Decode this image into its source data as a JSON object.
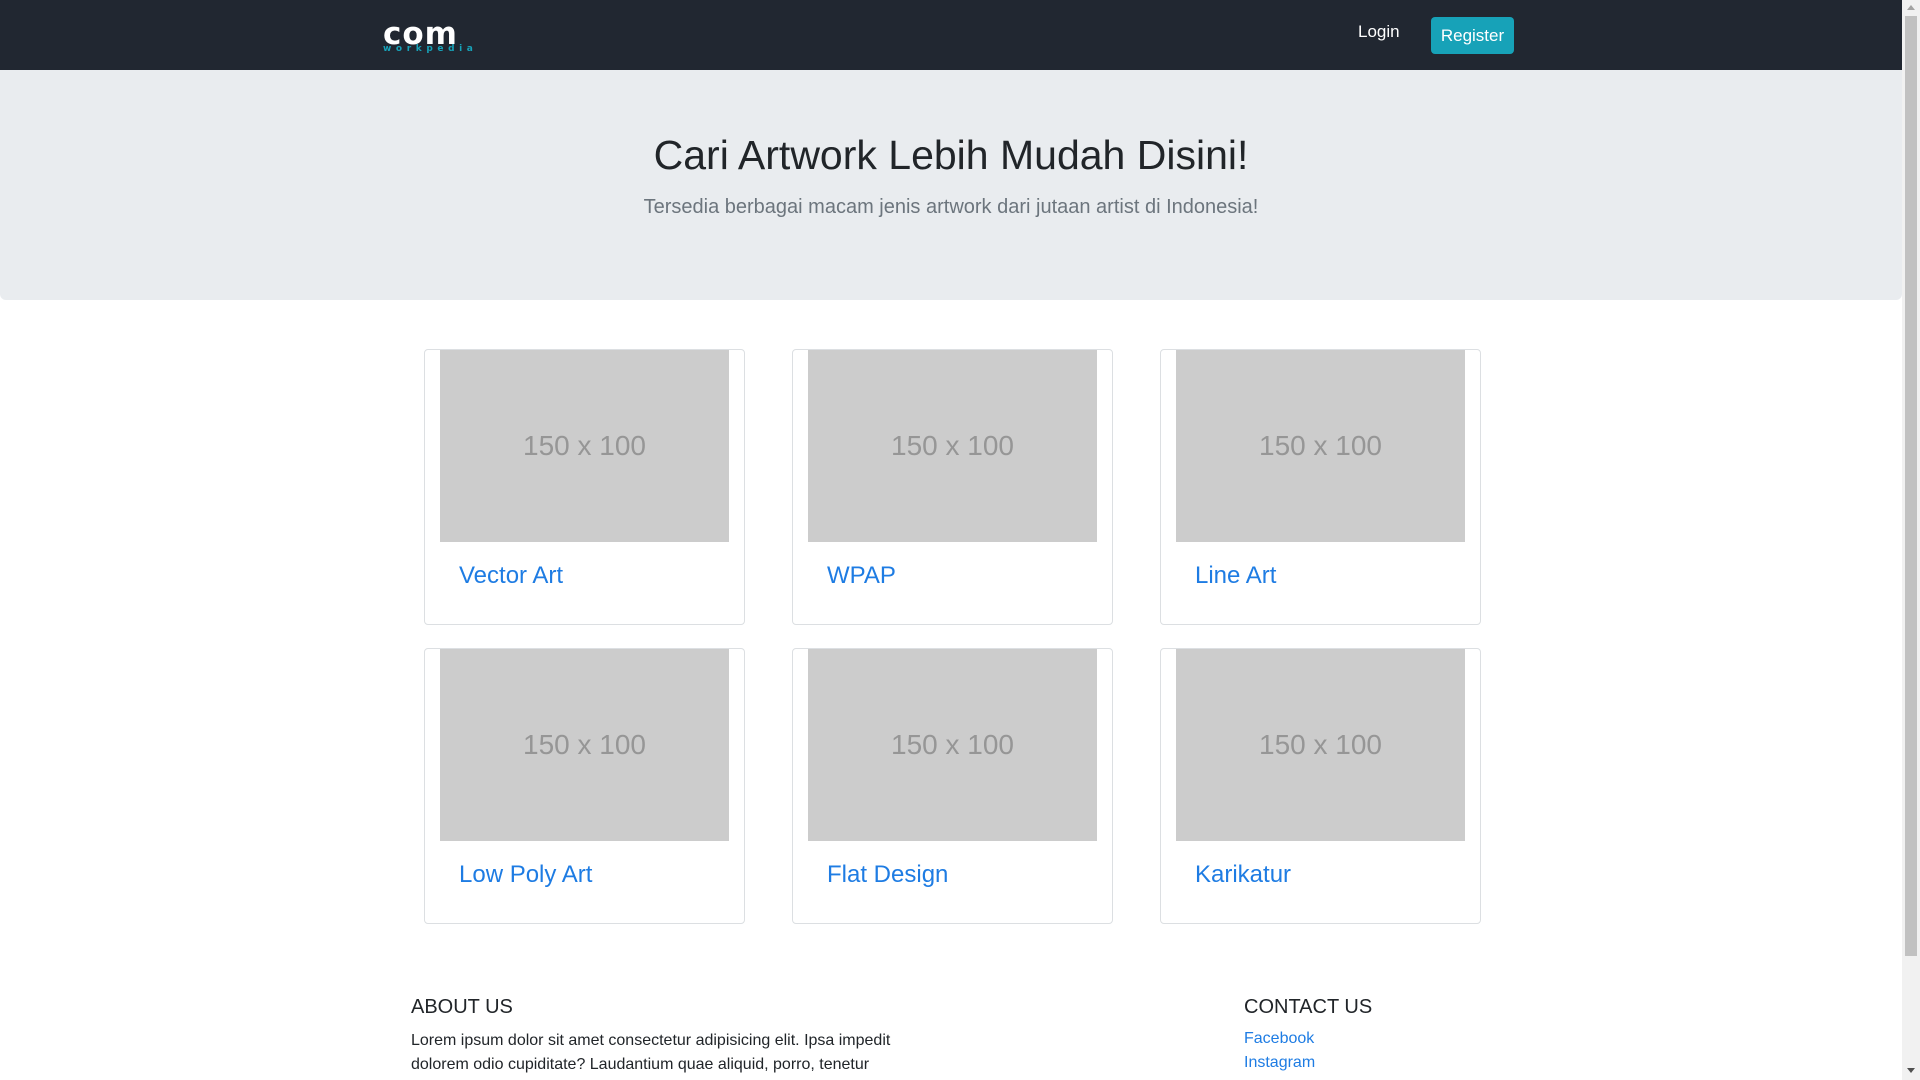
{
  "navbar": {
    "brand_main": "com",
    "brand_sub": "workpedia",
    "login_label": "Login",
    "register_label": "Register"
  },
  "jumbotron": {
    "title": "Cari Artwork Lebih Mudah Disini!",
    "lead": "Tersedia berbagai macam jenis artwork dari jutaan artist di Indonesia!"
  },
  "cards": [
    {
      "image_label": "150 x 100",
      "title": "Vector Art"
    },
    {
      "image_label": "150 x 100",
      "title": "WPAP"
    },
    {
      "image_label": "150 x 100",
      "title": "Line Art"
    },
    {
      "image_label": "150 x 100",
      "title": "Low Poly Art"
    },
    {
      "image_label": "150 x 100",
      "title": "Flat Design"
    },
    {
      "image_label": "150 x 100",
      "title": "Karikatur"
    }
  ],
  "footer": {
    "about_heading": "ABOUT US",
    "about_text": "Lorem ipsum dolor sit amet consectetur adipisicing elit. Ipsa impedit dolorem odio cupiditate? Laudantium quae aliquid, porro, tenetur",
    "contact_heading": "CONTACT US",
    "links": [
      "Facebook",
      "Instagram"
    ]
  },
  "colors": {
    "navbar_bg": "#212731",
    "accent": "#17a2b8",
    "link": "#1e7ce3",
    "jumbotron_bg": "#e9ecef",
    "placeholder_bg": "#cccccc"
  }
}
